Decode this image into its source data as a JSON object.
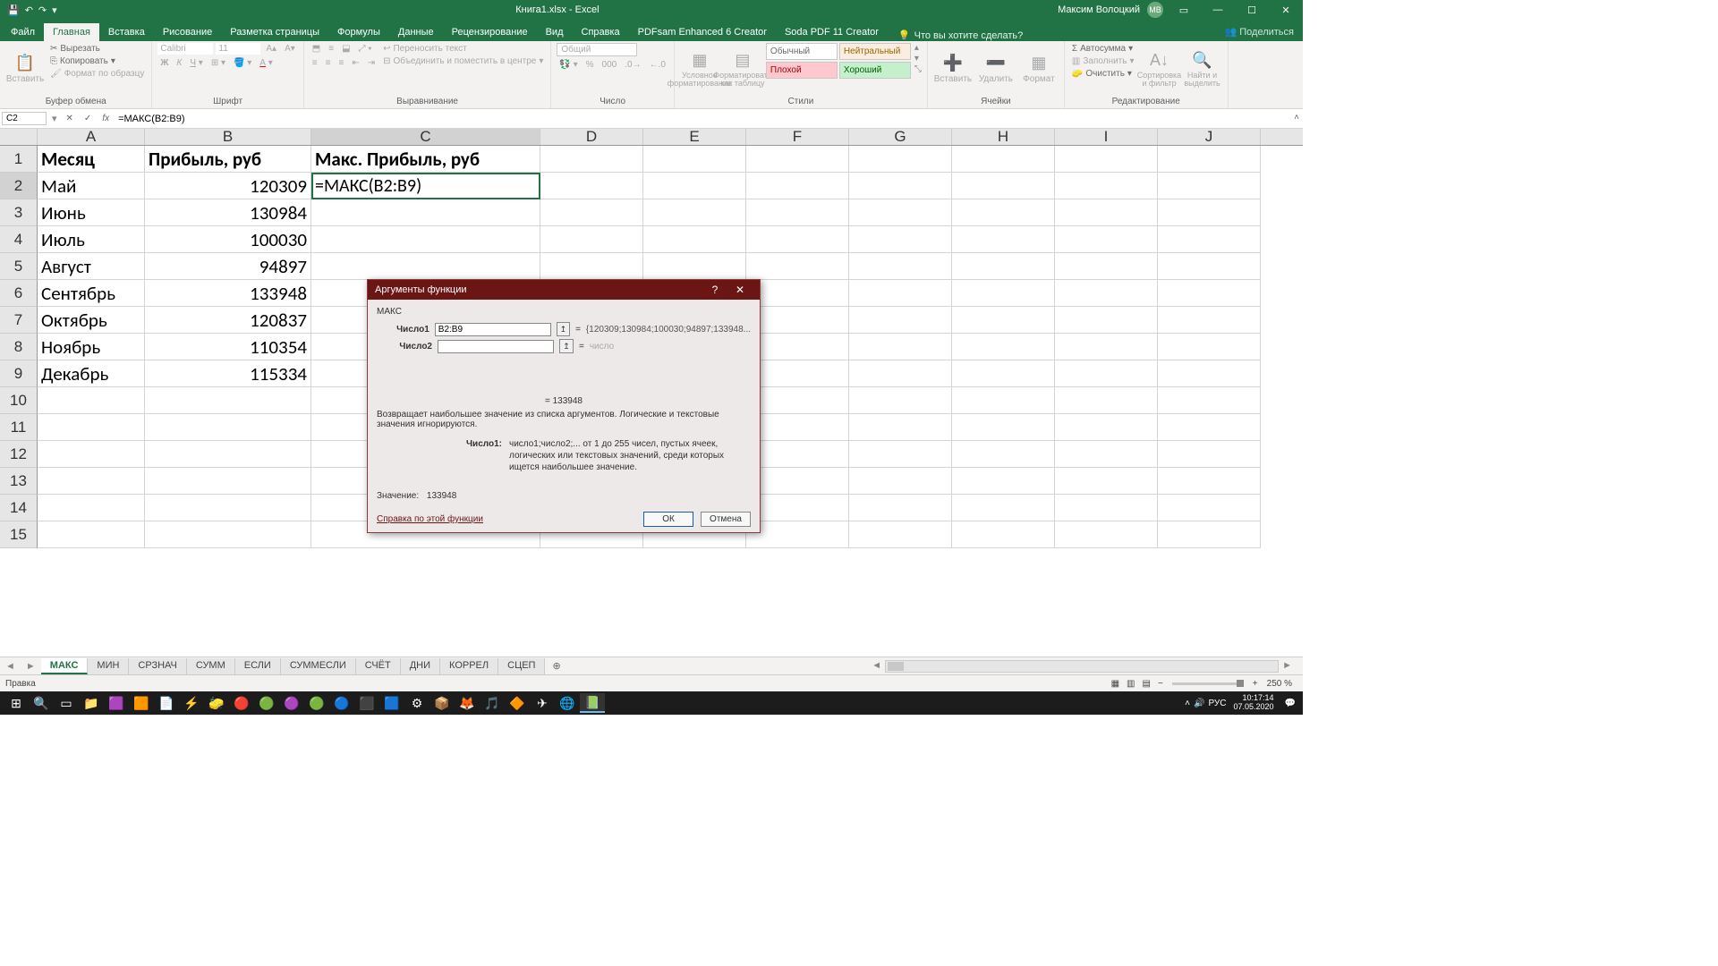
{
  "title": "Книга1.xlsx - Excel",
  "user": {
    "name": "Максим Волоцкий",
    "initials": "МВ"
  },
  "tabs": [
    "Файл",
    "Главная",
    "Вставка",
    "Рисование",
    "Разметка страницы",
    "Формулы",
    "Данные",
    "Рецензирование",
    "Вид",
    "Справка",
    "PDFsam Enhanced 6 Creator",
    "Soda PDF 11 Creator"
  ],
  "active_tab": "Главная",
  "tell_me": "Что вы хотите сделать?",
  "share": "Поделиться",
  "groups": {
    "clipboard": {
      "label": "Буфер обмена",
      "paste": "Вставить",
      "cut": "Вырезать",
      "copy": "Копировать",
      "format_painter": "Формат по образцу"
    },
    "font": {
      "label": "Шрифт",
      "family": "Calibri",
      "size": "11"
    },
    "alignment": {
      "label": "Выравнивание",
      "wrap": "Переносить текст",
      "merge": "Объединить и поместить в центре"
    },
    "number": {
      "label": "Число",
      "format": "Общий"
    },
    "styles": {
      "label": "Стили",
      "cond": "Условное форматирование",
      "table": "Форматировать как таблицу",
      "normal": "Обычный",
      "neutral": "Нейтральный",
      "bad": "Плохой",
      "good": "Хороший"
    },
    "cells": {
      "label": "Ячейки",
      "insert": "Вставить",
      "delete": "Удалить",
      "format": "Формат"
    },
    "editing": {
      "label": "Редактирование",
      "autosum": "Автосумма",
      "fill": "Заполнить",
      "clear": "Очистить",
      "sort": "Сортировка и фильтр",
      "find": "Найти и выделить"
    }
  },
  "name_box": "C2",
  "formula": "=МАКС(B2:B9)",
  "columns": [
    "A",
    "B",
    "C",
    "D",
    "E",
    "F",
    "G",
    "H",
    "I",
    "J"
  ],
  "headers": {
    "A": "Месяц",
    "B": "Прибыль, руб",
    "C": "Макс. Прибыль, руб"
  },
  "data_rows": [
    {
      "A": "Май",
      "B": "120309"
    },
    {
      "A": "Июнь",
      "B": "130984"
    },
    {
      "A": "Июль",
      "B": "100030"
    },
    {
      "A": "Август",
      "B": "94897"
    },
    {
      "A": "Сентябрь",
      "B": "133948"
    },
    {
      "A": "Октябрь",
      "B": "120837"
    },
    {
      "A": "Ноябрь",
      "B": "110354"
    },
    {
      "A": "Декабрь",
      "B": "115334"
    }
  ],
  "active_cell_display": "=МАКС(B2:B9)",
  "dialog": {
    "title": "Аргументы функции",
    "func": "МАКС",
    "arg1_label": "Число1",
    "arg1_value": "B2:B9",
    "arg1_preview": "{120309;130984;100030;94897;133948...",
    "arg2_label": "Число2",
    "arg2_preview": "число",
    "result_eq": "= 133948",
    "desc_main": "Возвращает наибольшее значение из списка аргументов. Логические и текстовые значения игнорируются.",
    "desc_arg_name": "Число1:",
    "desc_arg": "число1;число2;... от 1 до 255 чисел, пустых ячеек, логических или текстовых значений, среди которых ищется наибольшее значение.",
    "value_label": "Значение:",
    "value": "133948",
    "help": "Справка по этой функции",
    "ok": "ОК",
    "cancel": "Отмена"
  },
  "sheets": [
    "МАКС",
    "МИН",
    "СРЗНАЧ",
    "СУММ",
    "ЕСЛИ",
    "СУММЕСЛИ",
    "СЧЁТ",
    "ДНИ",
    "КОРРЕЛ",
    "СЦЕП"
  ],
  "active_sheet": "МАКС",
  "status": "Правка",
  "zoom": "250 %",
  "clock": {
    "time": "10:17:14",
    "date": "07.05.2020"
  },
  "lang": "РУС"
}
